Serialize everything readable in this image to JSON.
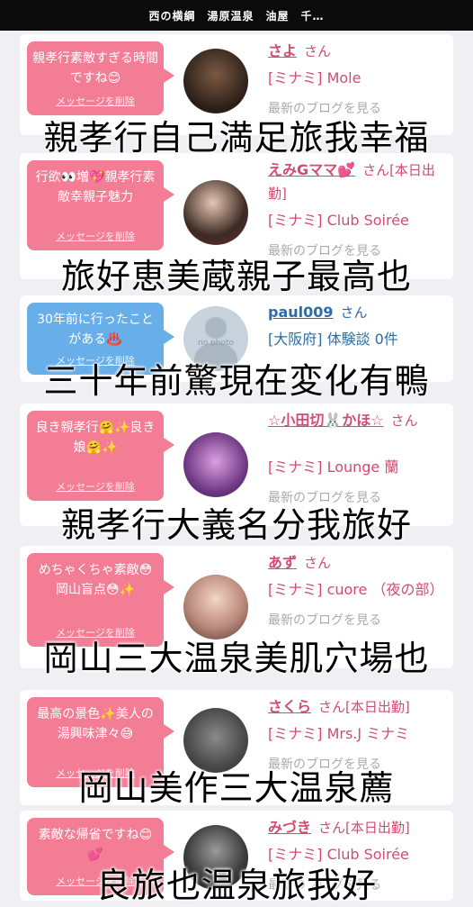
{
  "header": {
    "title": "西の横綱　湯原温泉　油屋　千…"
  },
  "entries": [
    {
      "message": "親孝行素敵すぎる時間ですね😊",
      "delete_label": "メッセージを削除",
      "name": "さよ",
      "suffix": "さん",
      "shop": "[ミナミ] Mole",
      "blog_link": "最新のブログを見る",
      "overlay": "親孝行自己満足旅我幸福"
    },
    {
      "message": "行欲👀増💖親孝行素敵幸親子魅力",
      "delete_label": "メッセージを削除",
      "name": "えみGママ💕",
      "suffix": "さん[本日出勤]",
      "shop": "[ミナミ] Club Soirée",
      "blog_link": "最新のブログを見る",
      "overlay": "旅好恵美蔵親子最高也"
    },
    {
      "message": "30年前に行ったことがある♨️",
      "delete_label": "メッセージを削除",
      "name": "paul009",
      "suffix": "さん",
      "shop": "[大阪府] 体験談 0件",
      "avatar_text": "no photo",
      "overlay": "三十年前驚現在変化有鴨"
    },
    {
      "message": "良き親孝行🤗✨良き娘🤗✨",
      "delete_label": "メッセージを削除",
      "name": "☆小田切🐰かほ☆",
      "suffix": "さん",
      "shop": "[ミナミ] Lounge 蘭",
      "blog_link": "最新のブログを見る",
      "overlay": "親孝行大義名分我旅好"
    },
    {
      "message": "めちゃくちゃ素敵😳岡山盲点😳✨",
      "delete_label": "メッセージを削除",
      "name": "あず",
      "suffix": "さん",
      "shop": "[ミナミ] cuore （夜の部）",
      "blog_link": "最新のブログを見る",
      "overlay": "岡山三大温泉美肌穴場也"
    },
    {
      "message": "最高の景色✨美人の湯興味津々😅",
      "delete_label": "メッセージを削除",
      "name": "さくら",
      "suffix": "さん[本日出勤]",
      "shop": "[ミナミ] Mrs.J ミナミ",
      "blog_link": "最新のブログを見る",
      "overlay": "岡山美作三大温泉薦"
    },
    {
      "message": "素敵な帰省ですね😊💕",
      "delete_label": "メッセージを削除",
      "name": "みづき",
      "suffix": "さん[本日出勤]",
      "shop": "[ミナミ] Club Soirée",
      "blog_link": "最新のブログを見る",
      "overlay": "良旅也温泉旅我好"
    }
  ]
}
